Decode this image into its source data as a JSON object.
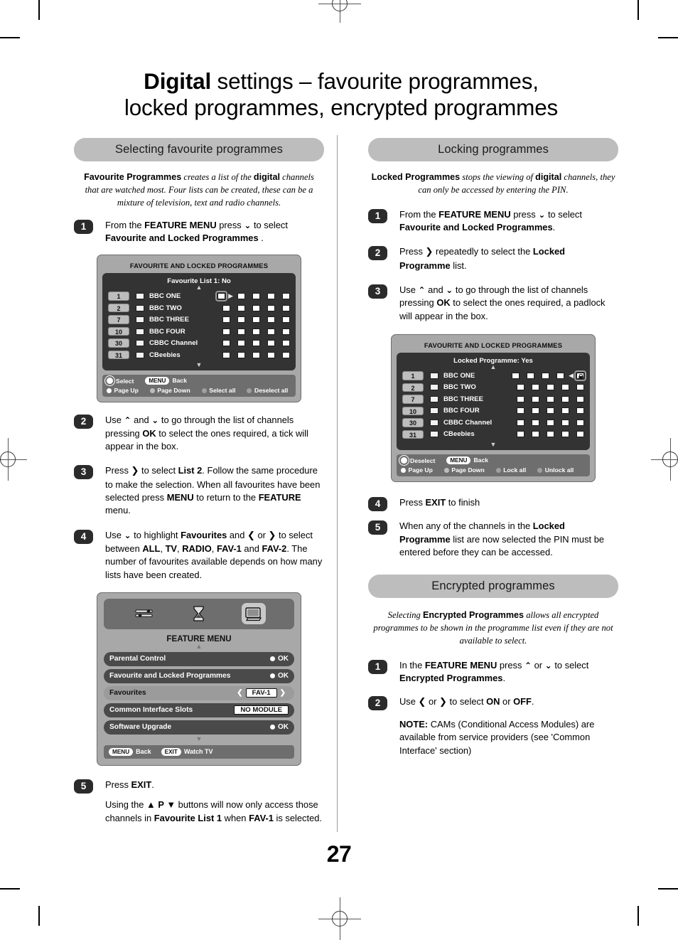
{
  "page": {
    "number": "27",
    "title_part_bold": "Digital",
    "title_part_rest": " settings –  favourite programmes,",
    "title_line2": "locked programmes, encrypted programmes"
  },
  "left_column": {
    "banner": "Selecting favourite programmes",
    "intro": {
      "b1": "Favourite Programmes",
      "i1": " creates a list of the ",
      "b2": "digital",
      "i2": " channels that are watched most. Four lists can be created, these can be a mixture of television, text and radio channels."
    },
    "steps": [
      {
        "num": "1",
        "text": "From the FEATURE MENU press ⌄ to select Favourite and Locked Programmes ."
      },
      {
        "num": "2",
        "text": "Use ⌃ and ⌄ to go through the list of channels pressing OK to select the ones required, a tick will appear in the box."
      },
      {
        "num": "3",
        "text": "Press ❯ to select List 2. Follow the same procedure to make the selection. When all favourites have been selected press MENU to return to the FEATURE menu."
      },
      {
        "num": "4",
        "text": "Use ⌄ to highlight Favourites and ❮ or ❯ to select between ALL, TV, RADIO, FAV-1 and FAV-2. The number of favourites available depends on how many lists have been created."
      },
      {
        "num": "5",
        "text": "Press EXIT."
      }
    ],
    "step5_note": "Using the ▲ P ▼ buttons will now only access those channels in Favourite List 1 when FAV-1 is selected.",
    "tv_screen": {
      "header": "FAVOURITE AND LOCKED PROGRAMMES",
      "subheader": "Favourite List 1: No",
      "channels": [
        {
          "number": "1",
          "name": "BBC ONE"
        },
        {
          "number": "2",
          "name": "BBC TWO"
        },
        {
          "number": "7",
          "name": "BBC THREE"
        },
        {
          "number": "10",
          "name": "BBC FOUR"
        },
        {
          "number": "30",
          "name": "CBBC Channel"
        },
        {
          "number": "31",
          "name": "CBeebies"
        }
      ],
      "columns": 5,
      "selected_row": 0,
      "selected_col": 0,
      "selection_marker": "tick-cursor",
      "footer": {
        "select_label": "Select",
        "menu_key": "MENU",
        "back_label": "Back",
        "page_up": "Page Up",
        "page_down": "Page Down",
        "action_1": "Select all",
        "action_2": "Deselect all"
      }
    },
    "feature_menu": {
      "title": "FEATURE MENU",
      "icons": [
        "sliders-icon",
        "hourglass-icon",
        "television-icon"
      ],
      "active_icon_index": 2,
      "rows": [
        {
          "label": "Parental Control",
          "value": "OK",
          "value_type": "ok",
          "style": "dark"
        },
        {
          "label": "Favourite and Locked Programmes",
          "value": "OK",
          "value_type": "ok",
          "style": "dark"
        },
        {
          "label": "Favourites",
          "value": "FAV-1",
          "value_type": "select",
          "style": "light"
        },
        {
          "label": "Common Interface Slots",
          "value": "NO MODULE",
          "value_type": "box",
          "style": "dark"
        },
        {
          "label": "Software Upgrade",
          "value": "OK",
          "value_type": "ok",
          "style": "dark"
        }
      ],
      "footer": {
        "menu_key": "MENU",
        "menu_label": "Back",
        "exit_key": "EXIT",
        "exit_label": "Watch TV"
      }
    }
  },
  "right_column": {
    "banner": "Locking programmes",
    "intro": {
      "b1": "Locked Programmes",
      "i1": " stops the viewing of ",
      "b2": "digital",
      "i2": " channels, they can only be accessed by entering the PIN."
    },
    "steps": [
      {
        "num": "1",
        "text": "From the FEATURE MENU press ⌄ to select Favourite and Locked Programmes."
      },
      {
        "num": "2",
        "text": "Press ❯ repeatedly to select the Locked Programme list."
      },
      {
        "num": "3",
        "text": "Use ⌃ and ⌄ to go through the list of channels pressing OK to select the ones required, a padlock will appear in the box."
      },
      {
        "num": "4",
        "text": "Press EXIT to finish"
      },
      {
        "num": "5",
        "text": "When any of the channels in the Locked Programme list are now selected the PIN must be entered before they can be accessed."
      }
    ],
    "tv_screen": {
      "header": "FAVOURITE AND LOCKED PROGRAMMES",
      "subheader": "Locked Programme: Yes",
      "channels": [
        {
          "number": "1",
          "name": "BBC ONE"
        },
        {
          "number": "2",
          "name": "BBC TWO"
        },
        {
          "number": "7",
          "name": "BBC THREE"
        },
        {
          "number": "10",
          "name": "BBC FOUR"
        },
        {
          "number": "30",
          "name": "CBBC Channel"
        },
        {
          "number": "31",
          "name": "CBeebies"
        }
      ],
      "columns": 5,
      "selected_row": 0,
      "selected_col": 4,
      "selection_marker": "padlock-cursor",
      "footer": {
        "select_label": "Deselect",
        "menu_key": "MENU",
        "back_label": "Back",
        "page_up": "Page Up",
        "page_down": "Page Down",
        "action_1": "Lock all",
        "action_2": "Unlock all"
      }
    },
    "encrypted": {
      "banner": "Encrypted programmes",
      "intro": {
        "i0": "Selecting ",
        "b1": "Encrypted Programmes",
        "i1": " allows all encrypted programmes to be shown in the programme list even if they are not available to select."
      },
      "steps": [
        {
          "num": "1",
          "text": "In the FEATURE MENU press ⌃ or ⌄ to  select Encrypted Programmes."
        },
        {
          "num": "2",
          "text": "Use ❮ or ❯ to select ON or OFF."
        }
      ],
      "note_label": "NOTE:",
      "note_text": " CAMs (Conditional Access Modules) are available from service providers (see 'Common Interface' section)"
    }
  },
  "colors": {
    "banner_bg": "#bdbdbd",
    "step_badge_bg": "#2b2b2b",
    "tv_bezel": "#a8a8a8",
    "tv_screen_bg": "#333333",
    "tv_footer_bg": "#6e6e6e",
    "menu_row_dark": "#4a4a4a",
    "menu_row_light": "#9b9b9b"
  }
}
